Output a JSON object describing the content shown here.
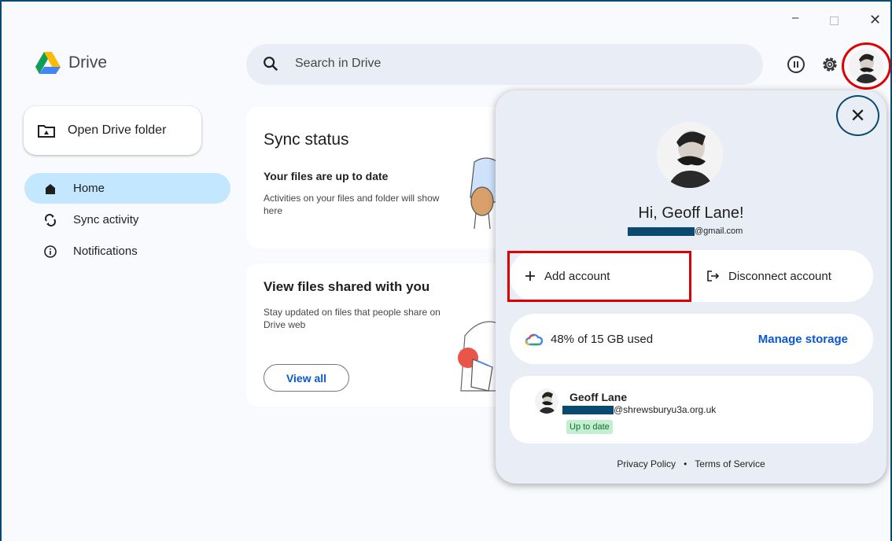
{
  "window": {
    "controls": {
      "minimize": "–",
      "maximize": "",
      "close": "✕"
    }
  },
  "app": {
    "name": "Drive"
  },
  "search": {
    "placeholder": "Search in Drive"
  },
  "sidebar": {
    "open_folder_label": "Open Drive folder",
    "items": [
      {
        "label": "Home",
        "icon": "home-icon",
        "active": true
      },
      {
        "label": "Sync activity",
        "icon": "sync-icon",
        "active": false
      },
      {
        "label": "Notifications",
        "icon": "info-icon",
        "active": false
      }
    ]
  },
  "cards": {
    "sync": {
      "title": "Sync status",
      "subtitle": "Your files are up to date",
      "description": "Activities on your files and folder will show here"
    },
    "shared": {
      "title": "View files shared with you",
      "description": "Stay updated on files that people share on Drive web",
      "button": "View all"
    }
  },
  "account_panel": {
    "close": "✕",
    "greeting": "Hi, Geoff Lane!",
    "email_suffix": "@gmail.com",
    "add_account": "Add account",
    "disconnect_account": "Disconnect account",
    "storage_used": "48% of 15 GB used",
    "manage_storage": "Manage storage",
    "account": {
      "name": "Geoff Lane",
      "email_suffix": "@shrewsburyu3a.org.uk",
      "status": "Up to date"
    },
    "footer": {
      "privacy": "Privacy Policy",
      "separator": "•",
      "terms": "Terms of Service"
    }
  },
  "colors": {
    "accent": "#0b57d0",
    "active_nav": "#c2e7ff",
    "highlight": "#e00000",
    "status_bg": "#c4eed0",
    "status_text": "#146c2e"
  }
}
